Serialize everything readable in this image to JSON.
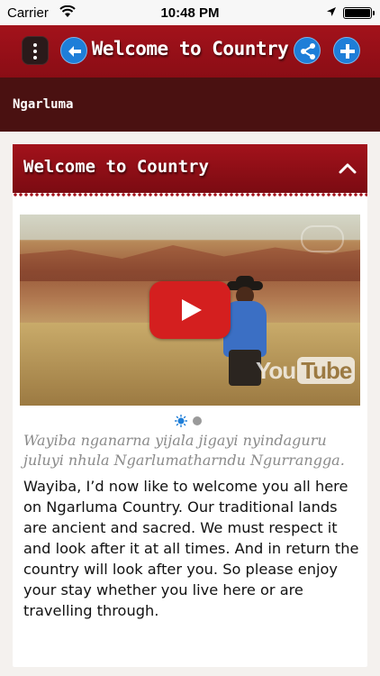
{
  "status_bar": {
    "carrier": "Carrier",
    "time": "10:48 PM"
  },
  "header": {
    "title": "Welcome to Country",
    "menu_icon": "vertical-dots-icon",
    "back_icon": "arrow-left-icon",
    "share_icon": "share-icon",
    "add_icon": "plus-icon",
    "accent_color": "#a3121b",
    "button_color": "#1e7ed8"
  },
  "subheader": {
    "title": "Ngarluma",
    "color": "#4a1111"
  },
  "section": {
    "title": "Welcome to Country",
    "toggle_icon": "chevron-up-icon"
  },
  "video": {
    "play_icon": "play-icon",
    "watermark_text": "You",
    "watermark_text_2": "Tube"
  },
  "pager": {
    "count": 2,
    "active_index": 0
  },
  "content": {
    "language_text": "Wayiba nganarna yijala jigayi nyindaguru juluyi nhula Ngarlumatharndu Ngurrangga.",
    "english_text": "Wayiba, I’d now like to welcome you all here on Ngarluma Country. Our traditional lands are ancient and sacred. We must respect it and look after it at all times. And in return the country will look after you. So please enjoy your stay whether you live here or are travelling through."
  }
}
